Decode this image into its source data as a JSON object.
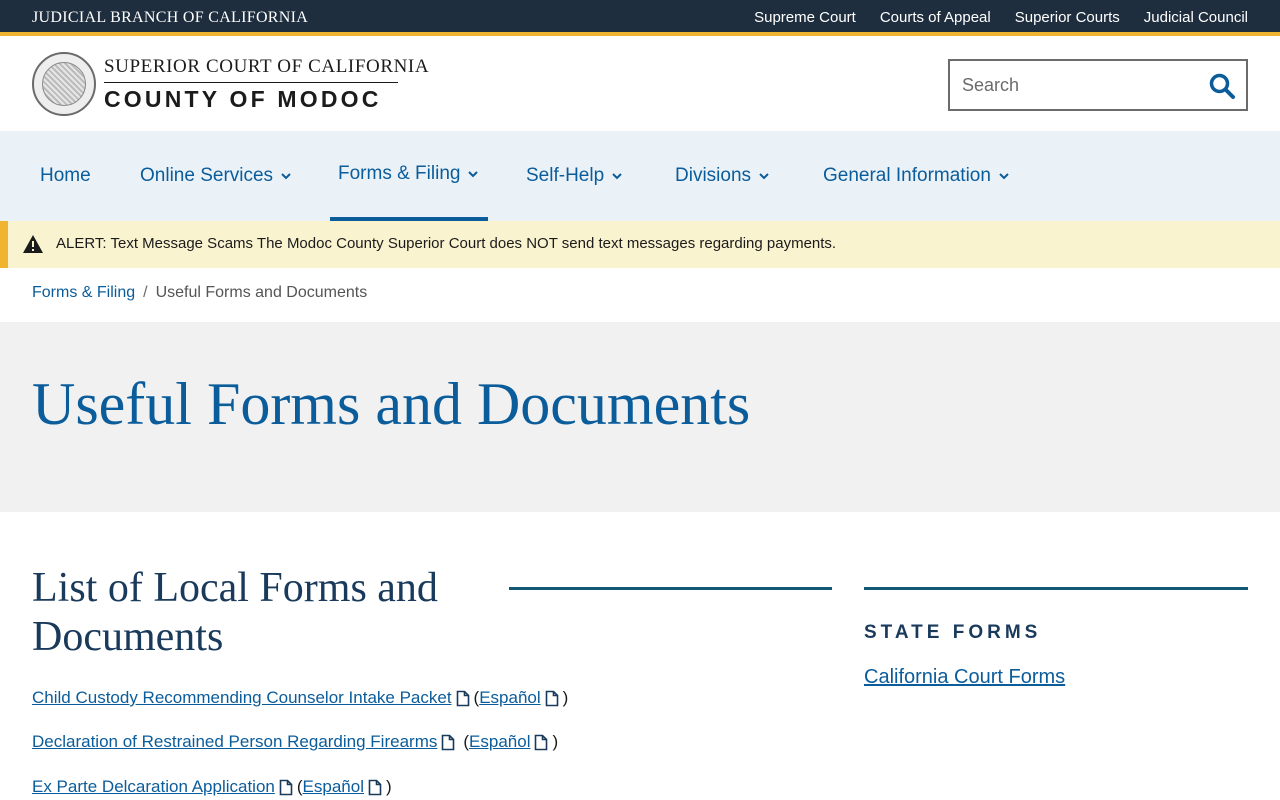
{
  "topbar": {
    "brand": "JUDICIAL BRANCH OF CALIFORNIA",
    "links": [
      "Supreme Court",
      "Courts of Appeal",
      "Superior Courts",
      "Judicial Council"
    ]
  },
  "header": {
    "logo_line1": "SUPERIOR COURT OF CALIFORNIA",
    "logo_line2": "COUNTY OF MODOC",
    "search_placeholder": "Search"
  },
  "nav": {
    "items": [
      {
        "label": "Home",
        "has_dropdown": false
      },
      {
        "label": "Online Services",
        "has_dropdown": true
      },
      {
        "label": "Forms & Filing",
        "has_dropdown": true,
        "active": true
      },
      {
        "label": "Self-Help",
        "has_dropdown": true
      },
      {
        "label": "Divisions",
        "has_dropdown": true
      },
      {
        "label": "General Information",
        "has_dropdown": true
      }
    ]
  },
  "alert": {
    "text": "ALERT: Text Message Scams The Modoc County Superior Court does NOT send text messages regarding payments."
  },
  "breadcrumb": {
    "parent": "Forms & Filing",
    "separator": "/",
    "current": "Useful Forms and Documents"
  },
  "page": {
    "title": "Useful Forms and Documents"
  },
  "main": {
    "section_title": "List of Local Forms and Documents",
    "documents": [
      {
        "title": "Child Custody Recommending Counselor Intake Packet",
        "alt_label": "Español"
      },
      {
        "title": "Declaration of Restrained Person Regarding Firearms",
        "alt_label": "Español"
      },
      {
        "title": "Ex Parte Delcaration Application",
        "alt_label": "Español"
      }
    ]
  },
  "sidebar": {
    "heading": "STATE FORMS",
    "link": "California Court Forms"
  },
  "colors": {
    "topbar_bg": "#1e2e3e",
    "accent_gold": "#f0b430",
    "link_blue": "#0b5c9a",
    "nav_bg": "#eaf2f8",
    "alert_bg": "#faf3d0"
  }
}
